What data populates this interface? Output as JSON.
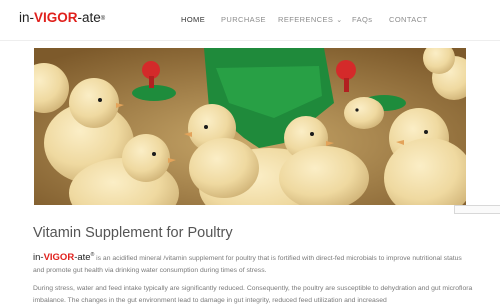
{
  "brand": {
    "prefix": "in-",
    "highlight": "VIGOR",
    "suffix": "-ate",
    "mark": "®"
  },
  "nav": {
    "items": [
      "HOME",
      "PURCHASE",
      "REFERENCES",
      "FAQs",
      "CONTACT"
    ],
    "active": "HOME"
  },
  "hero": {
    "image": "chicks-at-waterer"
  },
  "content": {
    "title": "Vitamin Supplement for Poultry",
    "p1_text": " is an acidified mineral /vitamin supplement for poultry that is fortified with direct-fed microbials to improve nutritional status and promote gut health via drinking water consumption during times of stress.",
    "p2_text": "During stress, water and feed intake typically are significantly reduced. Consequently, the poultry are susceptible to dehydration and gut microflora imbalance. The changes in the gut environment lead to damage in gut integrity, reduced feed utilization and increased"
  },
  "colors": {
    "accent": "#e0201c",
    "text": "#555555",
    "muted": "#7a7a7a"
  }
}
